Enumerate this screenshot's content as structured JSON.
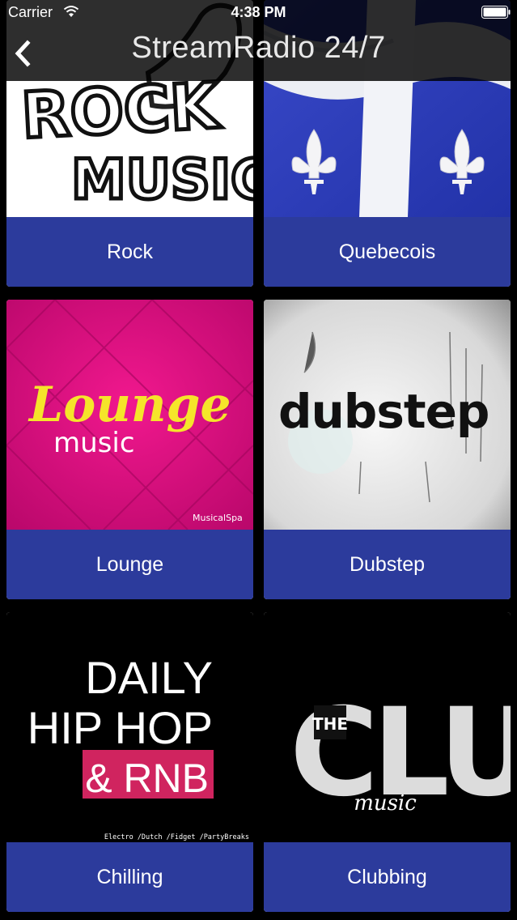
{
  "status_bar": {
    "carrier": "Carrier",
    "time": "4:38 PM"
  },
  "nav": {
    "title": "StreamRadio 24/7",
    "back_icon": "chevron-left-icon"
  },
  "colors": {
    "label_bg": "#2c3b9c",
    "background": "#000000"
  },
  "stations": [
    {
      "label": "Rock",
      "art_text": [
        "ROCK",
        "MUSIC"
      ]
    },
    {
      "label": "Quebecois",
      "art_text": []
    },
    {
      "label": "Lounge",
      "art_text": [
        "Lounge",
        "music",
        "MusicalSpa"
      ]
    },
    {
      "label": "Dubstep",
      "art_text": [
        "dubstep"
      ]
    },
    {
      "label": "Chilling",
      "art_text": [
        "DAILY",
        "HIP HOP",
        "& RNB",
        "Electro /Dutch /Fidget /PartyBreaks"
      ]
    },
    {
      "label": "Clubbing",
      "art_text": [
        "THE",
        "CLUB",
        "music"
      ]
    }
  ]
}
